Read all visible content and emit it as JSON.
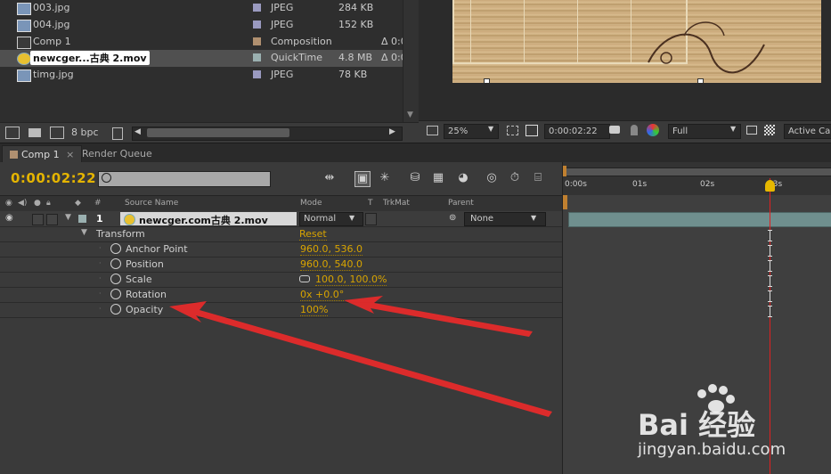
{
  "project": {
    "items": [
      {
        "name": "003.jpg",
        "type": "JPEG",
        "size": "284 KB",
        "duration": "",
        "label_color": "#9a9ac0"
      },
      {
        "name": "004.jpg",
        "type": "JPEG",
        "size": "152 KB",
        "duration": "",
        "label_color": "#9a9ac0"
      },
      {
        "name": "Comp 1",
        "type": "Composition",
        "size": "",
        "duration": "Δ 0:0",
        "label_color": "#b09070"
      },
      {
        "name": "newcger...古典 2.mov",
        "type": "QuickTime",
        "size": "4.8 MB",
        "duration": "Δ 0:0",
        "label_color": "#9ab0b0"
      },
      {
        "name": "timg.jpg",
        "type": "JPEG",
        "size": "78 KB",
        "duration": "",
        "label_color": "#9a9ac0"
      }
    ],
    "bit_depth": "8 bpc"
  },
  "viewer": {
    "zoom": "25%",
    "timecode": "0:00:02:22",
    "resolution": "Full",
    "camera": "Active Ca"
  },
  "tabs": [
    {
      "label": "Comp 1"
    },
    {
      "label": "Render Queue"
    }
  ],
  "timeline": {
    "current_time": "0:00:02:22",
    "columns": {
      "hash": "#",
      "source_name": "Source Name",
      "mode": "Mode",
      "t": "T",
      "trkmat": "TrkMat",
      "parent": "Parent"
    },
    "layer": {
      "index": "1",
      "name": "newcger.com古典 2.mov",
      "mode": "Normal",
      "parent": "None"
    },
    "transform_label": "Transform",
    "reset_label": "Reset",
    "properties": [
      {
        "name": "Anchor Point",
        "value": "960.0, 536.0"
      },
      {
        "name": "Position",
        "value": "960.0, 540.0"
      },
      {
        "name": "Scale",
        "value": "100.0, 100.0%"
      },
      {
        "name": "Rotation",
        "value": "0x +0.0°"
      },
      {
        "name": "Opacity",
        "value": "100%"
      }
    ],
    "ruler_ticks": [
      "0:00s",
      "01s",
      "02s",
      "03s"
    ]
  },
  "colors": {
    "timecode": "#e4b400",
    "value": "#d8a400",
    "cti": "#e02020",
    "arrow": "#ee2a2a"
  },
  "watermark": {
    "brand": "Bai 经验",
    "url": "jingyan.baidu.com"
  }
}
